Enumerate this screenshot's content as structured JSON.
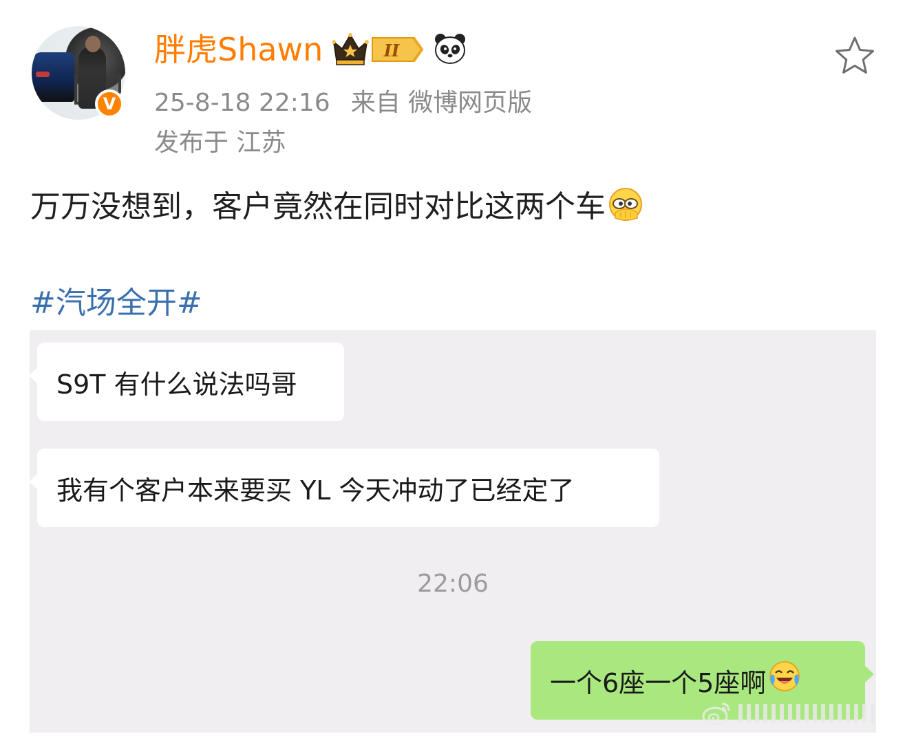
{
  "post": {
    "author": {
      "name": "胖虎Shawn",
      "verified_badge": "V",
      "vip_level": "II"
    },
    "timestamp": "25-8-18 22:16",
    "source": "来自 微博网页版",
    "location": "发布于 江苏",
    "text": "万万没想到，客户竟然在同时对比这两个车",
    "hashtag": "#汽场全开#",
    "favorite_icon": "star-outline-icon"
  },
  "chat": {
    "messages": [
      {
        "side": "left",
        "text": "S9T 有什么说法吗哥"
      },
      {
        "side": "left",
        "text": "我有个客户本来要买 YL 今天冲动了已经定了"
      },
      {
        "side": "right",
        "text": "一个6座一个5座啊"
      }
    ],
    "time_divider": "22:06"
  },
  "colors": {
    "username": "#ff7d00",
    "hashtag": "#3a6fb0",
    "meta": "#8a8a8a",
    "chat_bg": "#f1eef1",
    "bubble_self": "#a9e87e",
    "verified": "#ff8200"
  }
}
